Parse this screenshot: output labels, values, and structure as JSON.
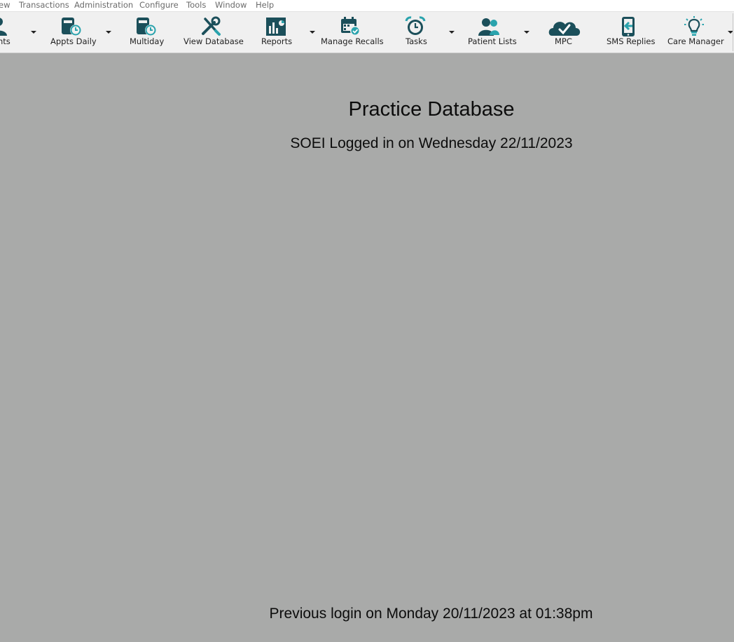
{
  "menu": [
    "ew",
    "Transactions",
    "Administration",
    "Configure",
    "Tools",
    "Window",
    "Help"
  ],
  "toolbar": {
    "appointments_label": "nts",
    "appts_daily_label": "Appts Daily",
    "multiday_label": "Multiday",
    "view_database_label": "View Database",
    "reports_label": "Reports",
    "manage_recalls_label": "Manage Recalls",
    "tasks_label": "Tasks",
    "patient_lists_label": "Patient Lists",
    "mpc_label": "MPC",
    "sms_replies_label": "SMS Replies",
    "care_manager_label": "Care Manager"
  },
  "main": {
    "title": "Practice Database",
    "login_status": "SOEI Logged in on Wednesday 22/11/2023",
    "previous_login": "Previous login on Monday 20/11/2023 at 01:38pm"
  },
  "colors": {
    "icon_dark": "#1b4f5a",
    "icon_accent": "#2aa3ad",
    "workspace": "#a9aaa9",
    "toolbar": "#f0f0f0"
  }
}
